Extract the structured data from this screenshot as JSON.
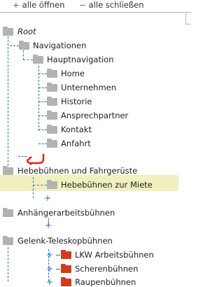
{
  "toolbar": {
    "open_all": "alle öffnen",
    "close_all": "alle schließen"
  },
  "tree": {
    "root": "Root",
    "navigationen": "Navigationen",
    "hauptnavigation": "Hauptnavigation",
    "hauptnav_items": [
      "Home",
      "Unternehmen",
      "Historie",
      "Ansprechpartner",
      "Kontakt",
      "Anfahrt"
    ],
    "hebebuehnen": "Hebebühnen und Fahrgerüste",
    "hebebuehnen_miete": "Hebebühnen zur Miete",
    "anhaenger": "Anhängerarbeitsbühnen",
    "gelenk": "Gelenk-Teleskopbühnen",
    "gelenk_items": [
      "LKW Arbeitsbühnen",
      "Scherenbühnen",
      "Raupenbühnen"
    ]
  },
  "colors": {
    "line": "#2b6fbf",
    "highlight": "#f0f1bf",
    "folder_grey": "#b2b2b2",
    "folder_red": "#d63a1e",
    "arrow": "#e0221c"
  }
}
